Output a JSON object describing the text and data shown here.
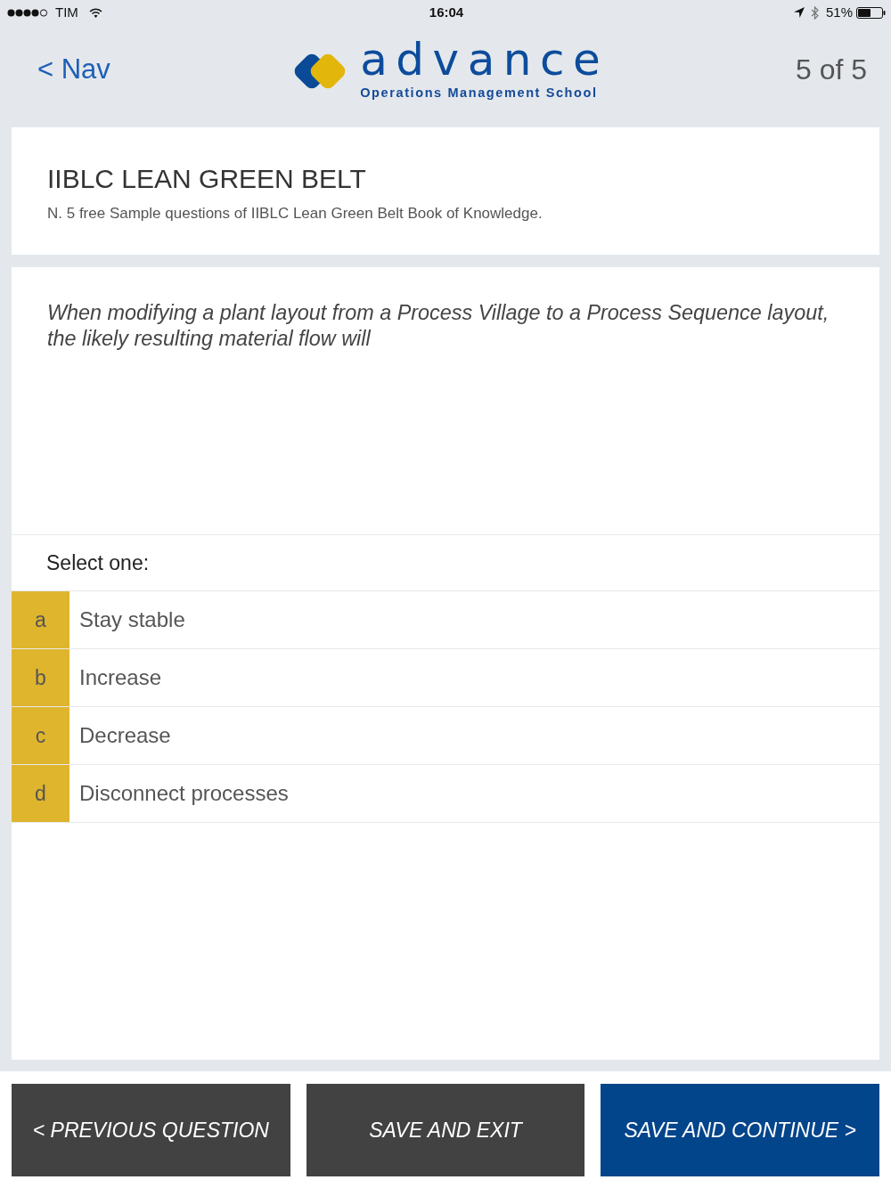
{
  "status_bar": {
    "carrier": "TIM",
    "time": "16:04",
    "battery": "51%"
  },
  "header": {
    "back_label": "< Nav",
    "logo": {
      "wordmark": "advance",
      "tagline": "Operations Management School"
    },
    "progress": "5 of 5"
  },
  "course_card": {
    "title": "IIBLC LEAN GREEN BELT",
    "description": "N. 5 free Sample questions of IIBLC Lean Green Belt Book of Knowledge."
  },
  "question": {
    "text": "When modifying a plant layout from a Process Village to a Process Sequence layout, the likely resulting material flow will",
    "prompt": "Select one:",
    "options": [
      {
        "letter": "a",
        "label": "Stay stable",
        "selected": false
      },
      {
        "letter": "b",
        "label": "Increase",
        "selected": false
      },
      {
        "letter": "c",
        "label": "Decrease",
        "selected": false
      },
      {
        "letter": "d",
        "label": "Disconnect processes",
        "selected": false
      }
    ]
  },
  "buttons": [
    {
      "label": "< PREVIOUS QUESTION",
      "kind": "secondary"
    },
    {
      "label": "SAVE AND EXIT",
      "kind": "secondary"
    },
    {
      "label": "SAVE AND CONTINUE >",
      "kind": "primary"
    }
  ]
}
